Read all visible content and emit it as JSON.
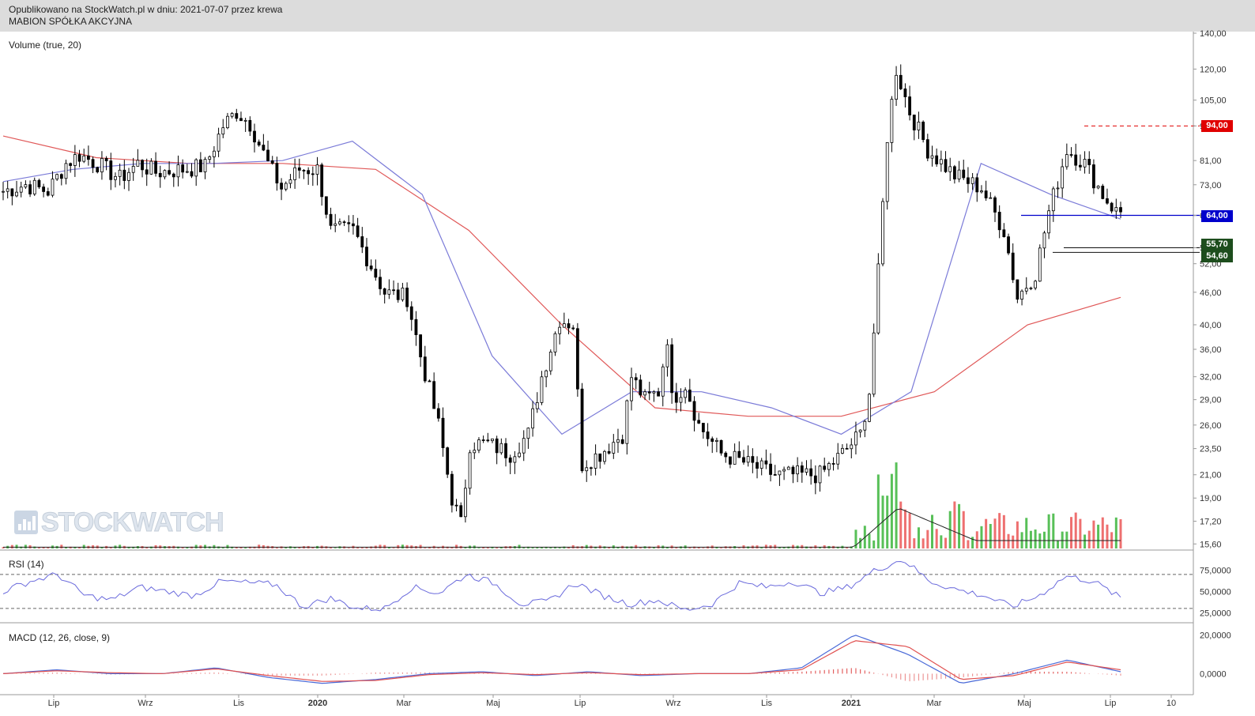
{
  "header": {
    "line1": "Opublikowano na StockWatch.pl w dniu: 2021-07-07 przez krewa",
    "line2": "MABION SPÓŁKA AKCYJNA"
  },
  "watermark": "STOCKWATCH",
  "colors": {
    "candle": "#000000",
    "ma_fast": "#7b7bd8",
    "ma_slow": "#e05858",
    "rsi": "#6a6adc",
    "macd": "#4a6ad8",
    "signal": "#e05050",
    "resistance": "#e00000",
    "support_blue": "#0000cc",
    "support_green": "#1d4d1d",
    "volume_up": "#58c058",
    "volume_down": "#ee7070"
  },
  "chart_data": [
    {
      "type": "candlestick",
      "title": "MABION SPÓŁKA AKCYJNA",
      "overlay_label": "Volume (true, 20)",
      "scale": "log",
      "y_ticks": [
        "140,00",
        "120,00",
        "105,00",
        "94,00",
        "81,00",
        "73,00",
        "64,00",
        "55,70",
        "52,00",
        "46,00",
        "40,00",
        "36,00",
        "32,00",
        "29,00",
        "26,00",
        "23,50",
        "21,00",
        "19,00",
        "17,20",
        "15,60"
      ],
      "x_ticks": [
        {
          "label": "Lip",
          "bold": false
        },
        {
          "label": "Wrz",
          "bold": false
        },
        {
          "label": "Lis",
          "bold": false
        },
        {
          "label": "2020",
          "bold": true
        },
        {
          "label": "Mar",
          "bold": false
        },
        {
          "label": "Maj",
          "bold": false
        },
        {
          "label": "Lip",
          "bold": false
        },
        {
          "label": "Wrz",
          "bold": false
        },
        {
          "label": "Lis",
          "bold": false
        },
        {
          "label": "2021",
          "bold": true
        },
        {
          "label": "Mar",
          "bold": false
        },
        {
          "label": "Maj",
          "bold": false
        },
        {
          "label": "Lip",
          "bold": false
        },
        {
          "label": "10",
          "bold": false
        }
      ],
      "price_path_approx": [
        [
          0,
          71
        ],
        [
          5,
          73
        ],
        [
          10,
          71
        ],
        [
          14,
          80
        ],
        [
          17,
          83
        ],
        [
          21,
          80
        ],
        [
          26,
          75
        ],
        [
          30,
          80
        ],
        [
          34,
          77
        ],
        [
          40,
          78
        ],
        [
          45,
          79
        ],
        [
          49,
          94
        ],
        [
          52,
          100
        ],
        [
          55,
          95
        ],
        [
          59,
          80
        ],
        [
          62,
          72
        ],
        [
          66,
          78
        ],
        [
          70,
          78
        ],
        [
          73,
          60
        ],
        [
          78,
          60
        ],
        [
          85,
          46
        ],
        [
          90,
          45
        ],
        [
          93,
          35
        ],
        [
          97,
          26
        ],
        [
          100,
          19
        ],
        [
          102,
          17
        ],
        [
          104,
          24
        ],
        [
          108,
          24
        ],
        [
          113,
          23
        ],
        [
          117,
          25
        ],
        [
          120,
          32
        ],
        [
          124,
          41
        ],
        [
          127,
          40
        ],
        [
          129,
          22
        ],
        [
          133,
          23
        ],
        [
          138,
          25
        ],
        [
          140,
          32
        ],
        [
          143,
          29
        ],
        [
          146,
          30
        ],
        [
          148,
          38
        ],
        [
          149,
          29
        ],
        [
          152,
          31
        ],
        [
          155,
          26
        ],
        [
          160,
          23
        ],
        [
          166,
          22
        ],
        [
          172,
          21
        ],
        [
          178,
          21
        ],
        [
          182,
          21
        ],
        [
          187,
          23
        ],
        [
          191,
          25
        ],
        [
          193,
          30
        ],
        [
          195,
          50
        ],
        [
          197,
          90
        ],
        [
          199,
          120
        ],
        [
          202,
          100
        ],
        [
          206,
          85
        ],
        [
          212,
          76
        ],
        [
          218,
          72
        ],
        [
          223,
          60
        ],
        [
          226,
          45
        ],
        [
          230,
          50
        ],
        [
          233,
          65
        ],
        [
          237,
          85
        ],
        [
          241,
          80
        ],
        [
          245,
          70
        ],
        [
          248,
          65
        ]
      ],
      "reference_levels": [
        {
          "label": "94,00",
          "value": 94.0,
          "style": "dashed-red"
        },
        {
          "label": "64,00",
          "value": 64.0,
          "style": "solid-blue"
        },
        {
          "label": "55,70",
          "value": 55.7,
          "style": "solid-black"
        },
        {
          "label": "54,60",
          "value": 54.6,
          "style": "solid-black"
        }
      ],
      "series": [
        {
          "name": "ma_fast",
          "values_approx": [
            74,
            78,
            80,
            80,
            81,
            88,
            70,
            35,
            25,
            30,
            30,
            28,
            25,
            30,
            80,
            70,
            63
          ]
        },
        {
          "name": "ma_slow",
          "values_approx": [
            90,
            82,
            80,
            80,
            78,
            60,
            40,
            28,
            27,
            27,
            30,
            40,
            45
          ]
        }
      ]
    },
    {
      "type": "line",
      "title": "RSI (14)",
      "y_ticks": [
        "75,0000",
        "50,0000",
        "25,0000"
      ],
      "ylim": [
        15,
        95
      ],
      "reference_lines": [
        70,
        30
      ],
      "values_approx": [
        50,
        62,
        70,
        45,
        40,
        55,
        50,
        45,
        62,
        60,
        58,
        32,
        42,
        30,
        30,
        55,
        48,
        70,
        60,
        35,
        38,
        60,
        45,
        35,
        40,
        28,
        35,
        60,
        55,
        62,
        48,
        55,
        75,
        88,
        62,
        52,
        45,
        32,
        45,
        68,
        62,
        42
      ]
    },
    {
      "type": "line",
      "title": "MACD (12, 26, close, 9)",
      "y_ticks": [
        "20,0000",
        "0,0000"
      ],
      "ylim": [
        -10,
        25
      ],
      "series": [
        {
          "name": "macd",
          "values_approx": [
            0,
            2,
            0,
            0,
            3,
            -2,
            -5,
            -3,
            0,
            1,
            -1,
            1,
            -1,
            0,
            0,
            3,
            20,
            10,
            -5,
            0,
            7,
            1
          ]
        },
        {
          "name": "signal",
          "values_approx": [
            0,
            1.5,
            0.5,
            0,
            2.5,
            -1,
            -4,
            -3.5,
            -0.5,
            0.5,
            -0.5,
            0.5,
            -0.5,
            0,
            0,
            2,
            17,
            14,
            -3,
            -1,
            6,
            2
          ]
        }
      ]
    }
  ]
}
